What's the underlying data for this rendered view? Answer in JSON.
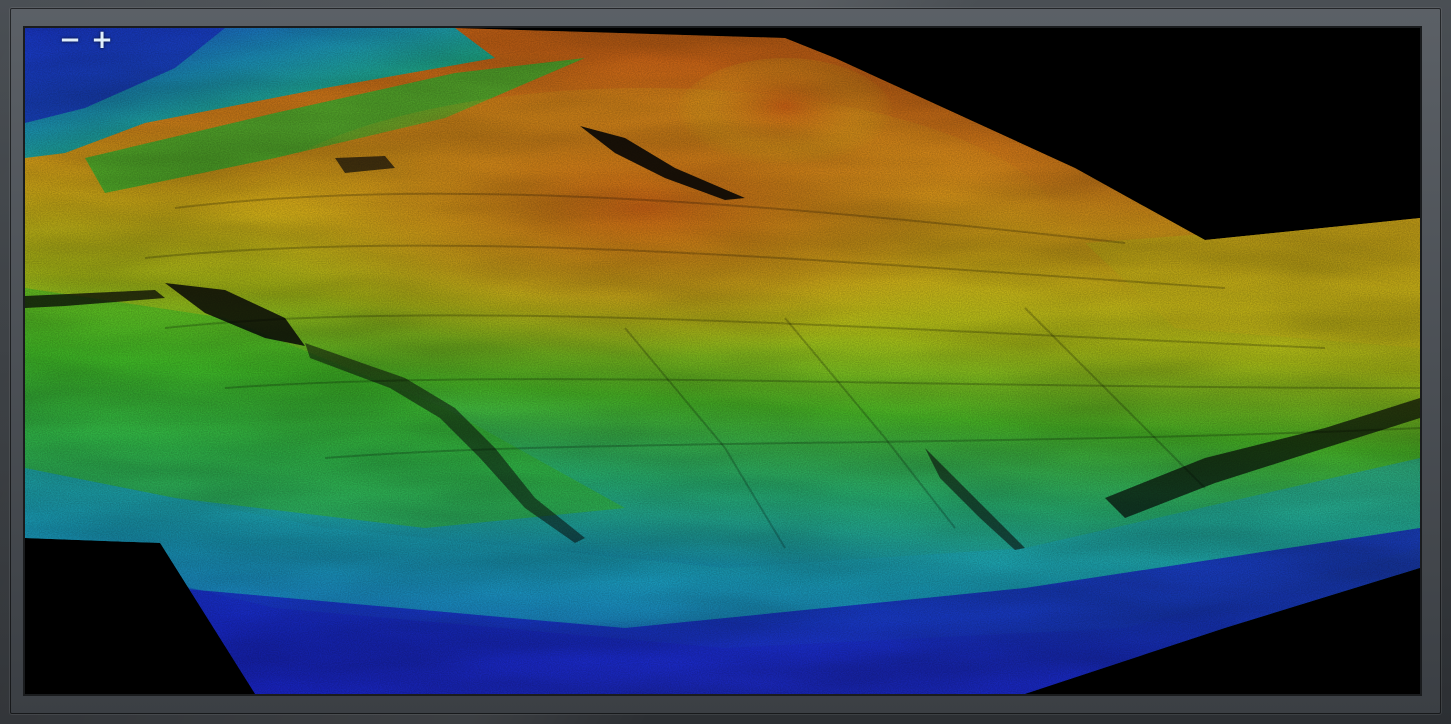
{
  "viewer": {
    "zoom_out_label": "−",
    "zoom_in_label": "+"
  },
  "colors": {
    "frame": "#3a3e42",
    "background": "#000000",
    "elevation_low": "#1a2fd0",
    "elevation_mid_low": "#1fb7c8",
    "elevation_mid": "#33c23a",
    "elevation_mid_high": "#d6d21c",
    "elevation_high": "#e07a1c"
  }
}
